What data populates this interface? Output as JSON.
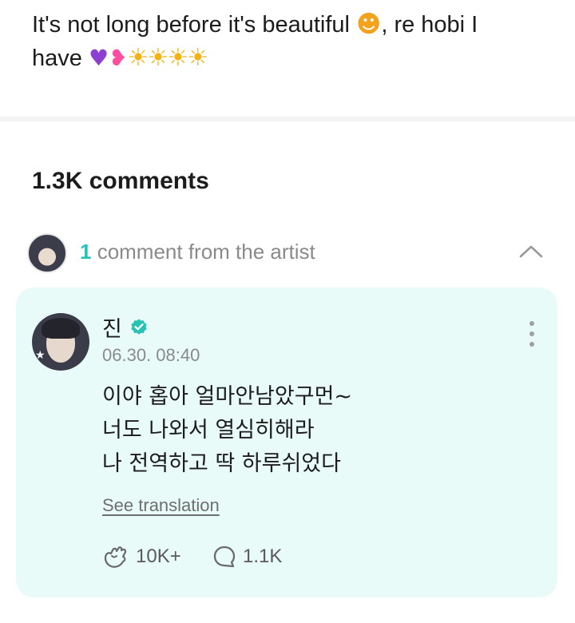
{
  "post": {
    "line1_text": "It's not long before it's beautiful ",
    "line1_emoji": "smiling-face-with-hearts",
    "line1_emoji_glyph": "☻",
    "line1_suffix": ", re hobi I",
    "line2_text": "have ",
    "line2_emojis": [
      {
        "name": "purple-heart",
        "glyph": "♥"
      },
      {
        "name": "two-hearts",
        "glyph": "❥"
      },
      {
        "name": "sun",
        "glyph": "☀"
      },
      {
        "name": "sun",
        "glyph": "☀"
      },
      {
        "name": "sun",
        "glyph": "☀"
      },
      {
        "name": "sun",
        "glyph": "☀"
      }
    ]
  },
  "comments": {
    "count_label": "1.3K comments"
  },
  "artist_comments": {
    "count": "1",
    "label": " comment from the artist",
    "toggle_icon": "chevron-up-icon"
  },
  "comment": {
    "author": "진",
    "verified_icon": "verified-badge-icon",
    "timestamp": "06.30. 08:40",
    "lines": [
      "이야 홉아 얼마안남았구먼~",
      "너도 나와서 열심히해라",
      "나 전역하고 딱 하루쉬었다"
    ],
    "translate_label": "See translation",
    "likes": "10K+",
    "replies": "1.1K",
    "more_icon": "more-vertical-icon"
  },
  "colors": {
    "accent": "#26c2b3",
    "card_background": "#e8fbf8",
    "muted_text": "#8a8a8a"
  }
}
